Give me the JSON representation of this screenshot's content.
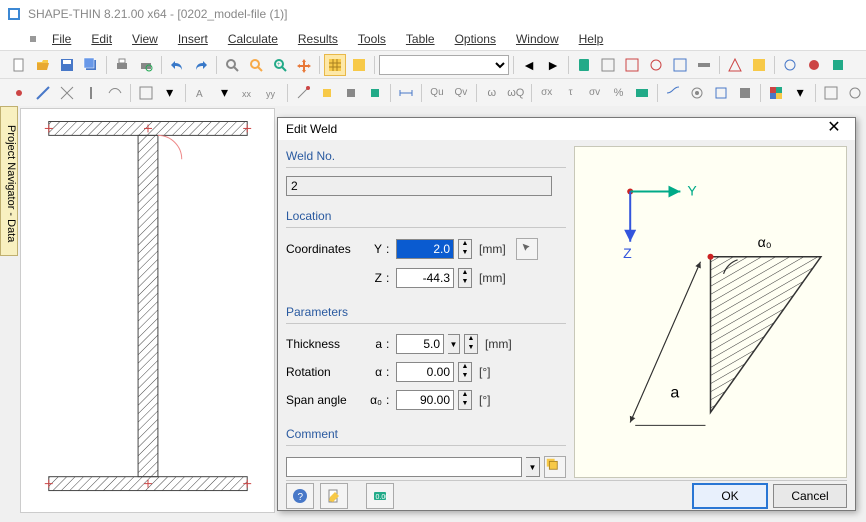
{
  "titlebar": {
    "text": "SHAPE-THIN 8.21.00 x64 - [0202_model-file (1)]"
  },
  "menu": {
    "items": [
      "File",
      "Edit",
      "View",
      "Insert",
      "Calculate",
      "Results",
      "Tools",
      "Table",
      "Options",
      "Window",
      "Help"
    ]
  },
  "sidetab": {
    "label": "Project Navigator - Data"
  },
  "dialog": {
    "title": "Edit Weld",
    "sections": {
      "weldno": {
        "heading": "Weld No.",
        "value": "2"
      },
      "location": {
        "heading": "Location",
        "coordinates_label": "Coordinates",
        "y_label": "Y",
        "y_value": "2.0",
        "y_unit": "[mm]",
        "z_label": "Z",
        "z_value": "-44.3",
        "z_unit": "[mm]"
      },
      "parameters": {
        "heading": "Parameters",
        "thickness_label": "Thickness",
        "thickness_sub": "a",
        "thickness_value": "5.0",
        "thickness_unit": "[mm]",
        "rotation_label": "Rotation",
        "rotation_sub": "α",
        "rotation_value": "0.00",
        "rotation_unit": "[°]",
        "span_label": "Span angle",
        "span_sub": "α₀",
        "span_value": "90.00",
        "span_unit": "[°]"
      },
      "comment": {
        "heading": "Comment",
        "value": ""
      }
    },
    "preview": {
      "y_label": "Y",
      "z_label": "Z",
      "a_label": "a",
      "a0_label": "α₀"
    },
    "buttons": {
      "ok": "OK",
      "cancel": "Cancel"
    }
  }
}
